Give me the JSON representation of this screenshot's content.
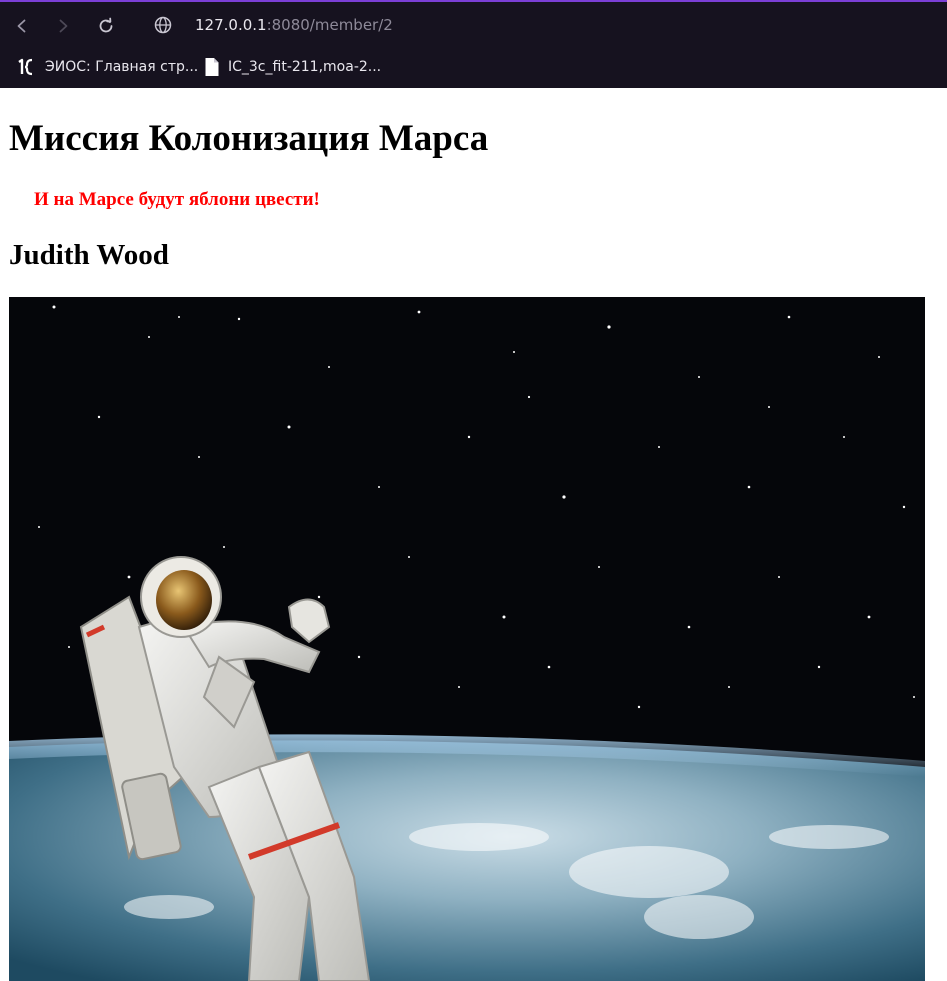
{
  "browser": {
    "url_host": "127.0.0.1",
    "url_path": ":8080/member/2",
    "bookmarks": [
      {
        "label": "ЭИОС: Главная стр...",
        "icon": "1c-logo-icon"
      },
      {
        "label": "IC_3c_fit-211,moa-2...",
        "icon": "file-icon"
      }
    ],
    "accent_color": "#7b3fd6"
  },
  "page": {
    "title": "Миссия Колонизация Марса",
    "slogan": "И на Марсе будут яблони цвести!",
    "member_name": "Judith Wood",
    "slogan_color": "#ff0000"
  }
}
